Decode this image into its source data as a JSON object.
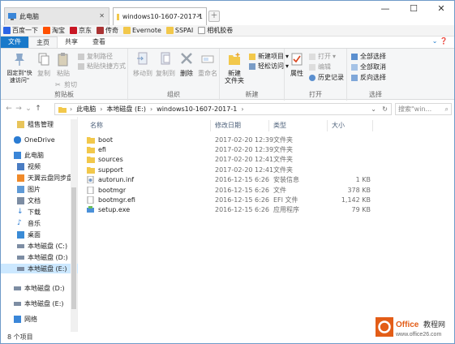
{
  "tabs": [
    {
      "label": "此电脑"
    },
    {
      "label": "windows10-1607-2017-1"
    }
  ],
  "window_controls": {
    "minimize": "—",
    "maximize": "☐",
    "close": "✕"
  },
  "favorites": [
    {
      "label": "百度一下",
      "color": "#2b65e6"
    },
    {
      "label": "淘宝",
      "color": "#ff5000"
    },
    {
      "label": "京东",
      "color": "#c81623"
    },
    {
      "label": "传奇",
      "color": "#a33"
    },
    {
      "label": "Evernote",
      "color": "#f2c84b"
    },
    {
      "label": "SSPAI",
      "color": "#f2c84b"
    },
    {
      "label": "相机胶卷",
      "color": "#ffffff"
    }
  ],
  "ribbon_tabs": {
    "file": "文件",
    "home": "主页",
    "share": "共享",
    "view": "查看"
  },
  "ribbon": {
    "pin": "固定到\"快速访问\"",
    "copy": "复制",
    "paste": "粘贴",
    "cut": "剪切",
    "copy_path": "复制路径",
    "paste_shortcut": "粘贴快捷方式",
    "clipboard": "剪贴板",
    "move_to": "移动到",
    "copy_to": "复制到",
    "delete": "删除",
    "rename": "重命名",
    "organize": "组织",
    "new_folder": "新建\n文件夹",
    "new_item": "新建项目",
    "easy_access": "轻松访问",
    "new": "新建",
    "properties": "属性",
    "open": "打开",
    "edit": "编辑",
    "history": "历史记录",
    "open_group": "打开",
    "select_all": "全部选择",
    "select_none": "全部取消",
    "invert": "反向选择",
    "select": "选择"
  },
  "address": {
    "segments": [
      "此电脑",
      "本地磁盘 (E:)",
      "windows10-1607-2017-1"
    ],
    "search_placeholder": "搜索\"win..."
  },
  "nav_items": [
    {
      "label": "租售管理",
      "color": "#e8c45a"
    },
    {
      "label": "OneDrive",
      "color": "#2b7cd3"
    },
    {
      "label": "此电脑",
      "color": "#3a86d8"
    },
    {
      "label": "视频",
      "color": "#4a7cc2"
    },
    {
      "label": "天翼云盘同步盘",
      "color": "#f08a2a"
    },
    {
      "label": "图片",
      "color": "#5f9ad6"
    },
    {
      "label": "文档",
      "color": "#7d8da3"
    },
    {
      "label": "下载",
      "color": "#2b7cd3"
    },
    {
      "label": "音乐",
      "color": "#2b7cd3"
    },
    {
      "label": "桌面",
      "color": "#3a8bd6"
    },
    {
      "label": "本地磁盘 (C:)",
      "color": "#7d8da3"
    },
    {
      "label": "本地磁盘 (D:)",
      "color": "#7d8da3"
    },
    {
      "label": "本地磁盘 (E:)",
      "color": "#7d8da3"
    },
    {
      "label": "本地磁盘 (D:)",
      "color": "#7d8da3"
    },
    {
      "label": "本地磁盘 (E:)",
      "color": "#7d8da3"
    },
    {
      "label": "网络",
      "color": "#3a86d8"
    }
  ],
  "columns": {
    "name": "名称",
    "date": "修改日期",
    "type": "类型",
    "size": "大小"
  },
  "files": [
    {
      "name": "boot",
      "date": "2017-02-20 12:39",
      "type": "文件夹",
      "size": "",
      "icon": "folder"
    },
    {
      "name": "efi",
      "date": "2017-02-20 12:39",
      "type": "文件夹",
      "size": "",
      "icon": "folder"
    },
    {
      "name": "sources",
      "date": "2017-02-20 12:41",
      "type": "文件夹",
      "size": "",
      "icon": "folder"
    },
    {
      "name": "support",
      "date": "2017-02-20 12:41",
      "type": "文件夹",
      "size": "",
      "icon": "folder"
    },
    {
      "name": "autorun.inf",
      "date": "2016-12-15 6:26",
      "type": "安装信息",
      "size": "1 KB",
      "icon": "inf"
    },
    {
      "name": "bootmgr",
      "date": "2016-12-15 6:26",
      "type": "文件",
      "size": "378 KB",
      "icon": "file"
    },
    {
      "name": "bootmgr.efi",
      "date": "2016-12-15 6:26",
      "type": "EFI 文件",
      "size": "1,142 KB",
      "icon": "file"
    },
    {
      "name": "setup.exe",
      "date": "2016-12-15 6:26",
      "type": "应用程序",
      "size": "79 KB",
      "icon": "exe"
    }
  ],
  "status": "8 个项目",
  "watermark": {
    "title": "Office教程网",
    "url": "www.office26.com"
  },
  "colors": {
    "accent": "#1979ca",
    "selection": "#cce8ff",
    "folder": "#f2c84b"
  }
}
